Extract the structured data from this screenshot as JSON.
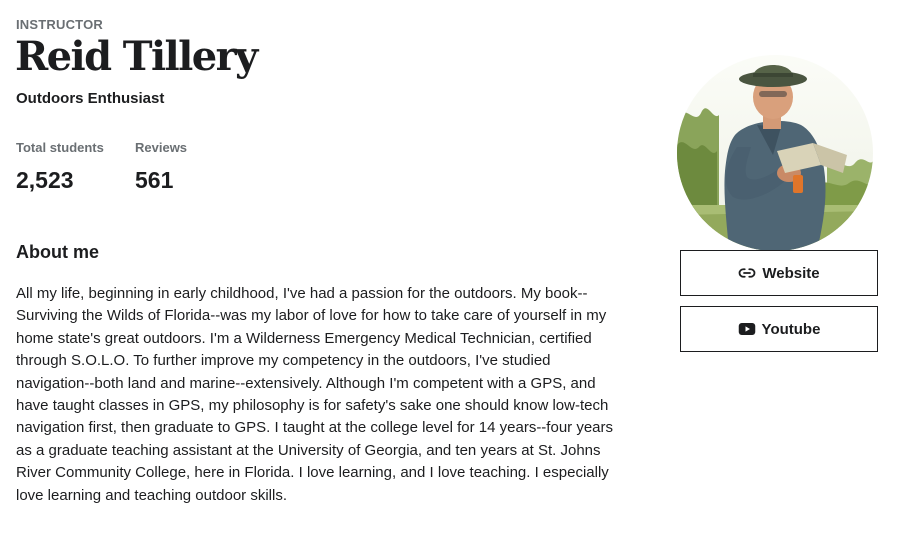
{
  "header": {
    "eyebrow": "INSTRUCTOR",
    "name": "Reid Tillery",
    "headline": "Outdoors Enthusiast"
  },
  "stats": {
    "students_label": "Total students",
    "students_value": "2,523",
    "reviews_label": "Reviews",
    "reviews_value": "561"
  },
  "about": {
    "heading": "About me",
    "bio": "All my life, beginning in early childhood, I've had a passion for the outdoors. My book--Surviving the Wilds of Florida--was my labor of love for how to take care of yourself in my home state's great outdoors. I'm a Wilderness Emergency Medical Technician, certified through S.O.L.O. To further improve my competency in the outdoors, I've studied navigation--both land and marine--extensively. Although I'm competent with a GPS, and have taught classes in GPS, my philosophy is for safety's sake one should know low-tech navigation first, then graduate to GPS. I taught at the college level for 14 years--four years as a graduate teaching assistant at the University of Georgia, and ten years at St. Johns River Community College, here in Florida. I love learning, and I love teaching. I especially love learning and teaching outdoor skills."
  },
  "links": {
    "website": {
      "label": "Website",
      "icon": "link-icon"
    },
    "youtube": {
      "label": "Youtube",
      "icon": "youtube-icon"
    }
  },
  "avatar": {
    "icon": "instructor-photo"
  }
}
